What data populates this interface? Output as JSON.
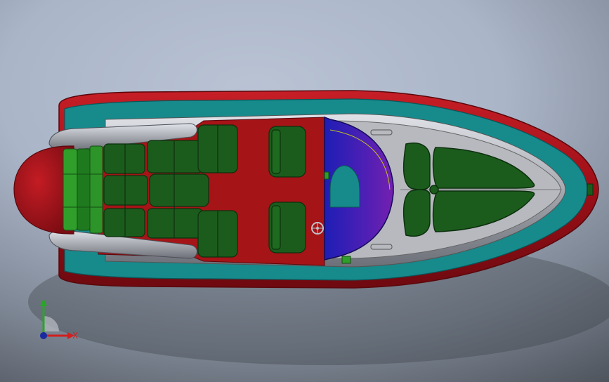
{
  "viewport": {
    "background_top": "#b9c3d4",
    "background_bottom": "#4a4f57"
  },
  "model": {
    "colors": {
      "tube_red": "#a5121c",
      "hull_teal": "#178a8c",
      "deck_gray": "#a9acb4",
      "deck_red": "#a51417",
      "seat_green": "#1b5c1c",
      "seat_bright_green": "#2f9e2a",
      "console_blue": "#2020b8",
      "console_purple": "#6a1fb0"
    },
    "icons": [
      "steering-wheel-icon",
      "cleat-icon",
      "hatch-icon"
    ]
  },
  "triad": {
    "y_label": "Y",
    "x_label": "X",
    "y_color": "#2aa52a",
    "x_color": "#d02020",
    "z_color": "#1a2aa0"
  }
}
